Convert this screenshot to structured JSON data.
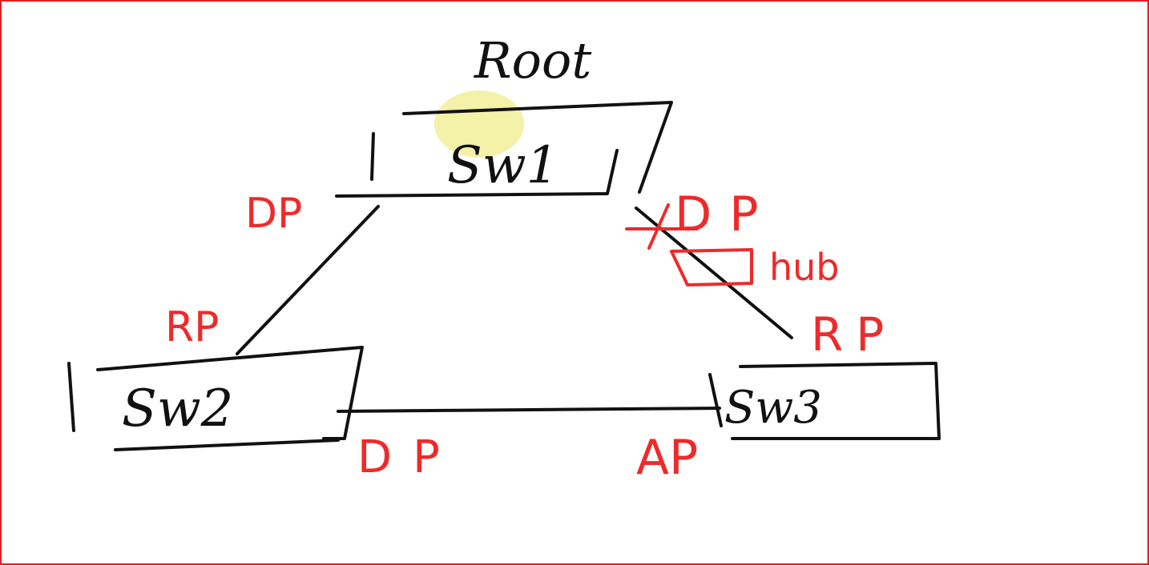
{
  "diagram": {
    "root_label": "Root",
    "switches": [
      {
        "id": "sw1",
        "label": "Sw1"
      },
      {
        "id": "sw2",
        "label": "Sw2"
      },
      {
        "id": "sw3",
        "label": "Sw3"
      }
    ],
    "port_labels": {
      "sw1_left": "DP",
      "sw1_right": "DP",
      "sw2_top": "RP",
      "sw2_right": "DP",
      "sw3_top": "RP",
      "sw3_left": "AP"
    },
    "hub_label": "hub",
    "colors": {
      "ink": "#111111",
      "annotation": "#ee2a2a",
      "highlight": "#f2ef9a",
      "frame": "#e02020"
    }
  }
}
